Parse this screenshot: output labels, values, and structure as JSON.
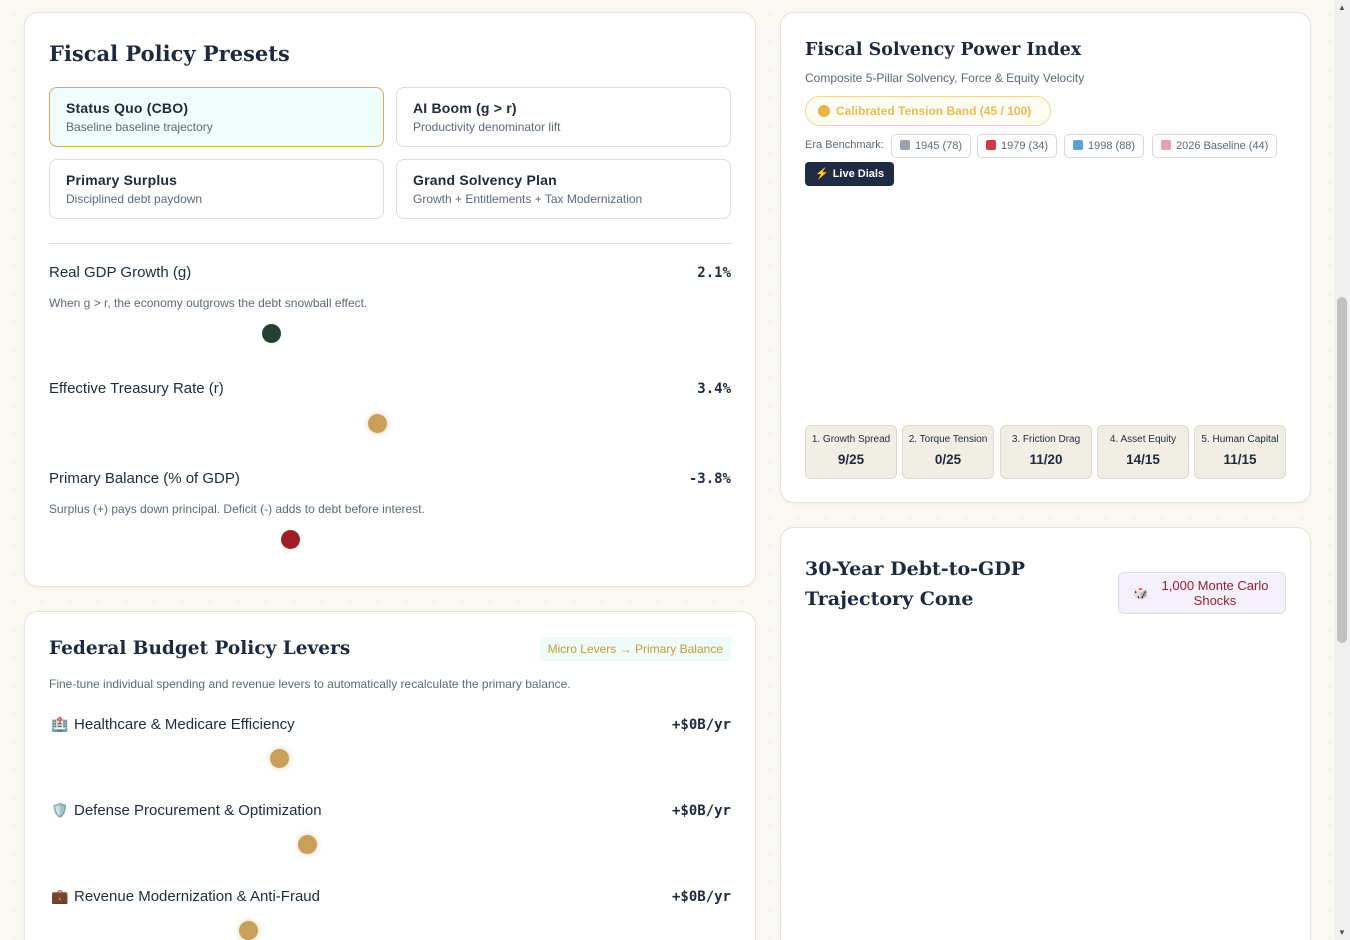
{
  "presets": {
    "title": "Fiscal Policy Presets",
    "items": [
      {
        "title": "Status Quo (CBO)",
        "subtitle": "Baseline baseline trajectory"
      },
      {
        "title": "AI Boom (g > r)",
        "subtitle": "Productivity denominator lift"
      },
      {
        "title": "Primary Surplus",
        "subtitle": "Disciplined debt paydown"
      },
      {
        "title": "Grand Solvency Plan",
        "subtitle": "Growth + Entitlements + Tax Modernization"
      }
    ],
    "selected": "Status Quo (CBO)"
  },
  "macro": {
    "gdp": {
      "label": "Real GDP Growth (g)",
      "value": "2.1%",
      "desc": "When g > r, the economy outgrows the debt snowball effect."
    },
    "treasury": {
      "label": "Effective Treasury Rate (r)",
      "value": "3.4%"
    },
    "balance": {
      "label": "Primary Balance (% of GDP)",
      "value": "-3.8%",
      "desc": "Surplus (+) pays down principal. Deficit (-) adds to debt before interest."
    }
  },
  "levers": {
    "title": "Federal Budget Policy Levers",
    "tag": "Micro Levers → Primary Balance",
    "desc": "Fine-tune individual spending and revenue levers to automatically recalculate the primary balance.",
    "items": [
      {
        "icon": "🏥",
        "label": "Healthcare & Medicare Efficiency",
        "value": "+$0B/yr"
      },
      {
        "icon": "🛡️",
        "label": "Defense Procurement & Optimization",
        "value": "+$0B/yr"
      },
      {
        "icon": "💼",
        "label": "Revenue Modernization & Anti-Fraud",
        "value": "+$0B/yr"
      }
    ]
  },
  "index": {
    "title": "Fiscal Solvency Power Index",
    "subtitle": "Composite 5-Pillar Solvency, Force & Equity Velocity",
    "band": "Calibrated Tension Band (45 / 100)",
    "era_label": "Era Benchmark:",
    "eras": [
      "1945 (78)",
      "1979 (34)",
      "1998 (88)",
      "2026 Baseline (44)"
    ],
    "live_button": "Live Dials",
    "pillars": [
      {
        "label": "1. Growth Spread",
        "value": "9/25"
      },
      {
        "label": "2. Torque Tension",
        "value": "0/25"
      },
      {
        "label": "3. Friction Drag",
        "value": "11/20"
      },
      {
        "label": "4. Asset Equity",
        "value": "14/15"
      },
      {
        "label": "5. Human Capital",
        "value": "11/15"
      }
    ]
  },
  "cone": {
    "title": "30-Year Debt-to-GDP Trajectory Cone",
    "badge": "1,000 Monte Carlo Shocks"
  },
  "colors": {
    "navy": "#1c2940",
    "gold": "#c9a05a",
    "green": "#234230",
    "red": "#a11d24",
    "selected_bg": "#effdfb"
  }
}
